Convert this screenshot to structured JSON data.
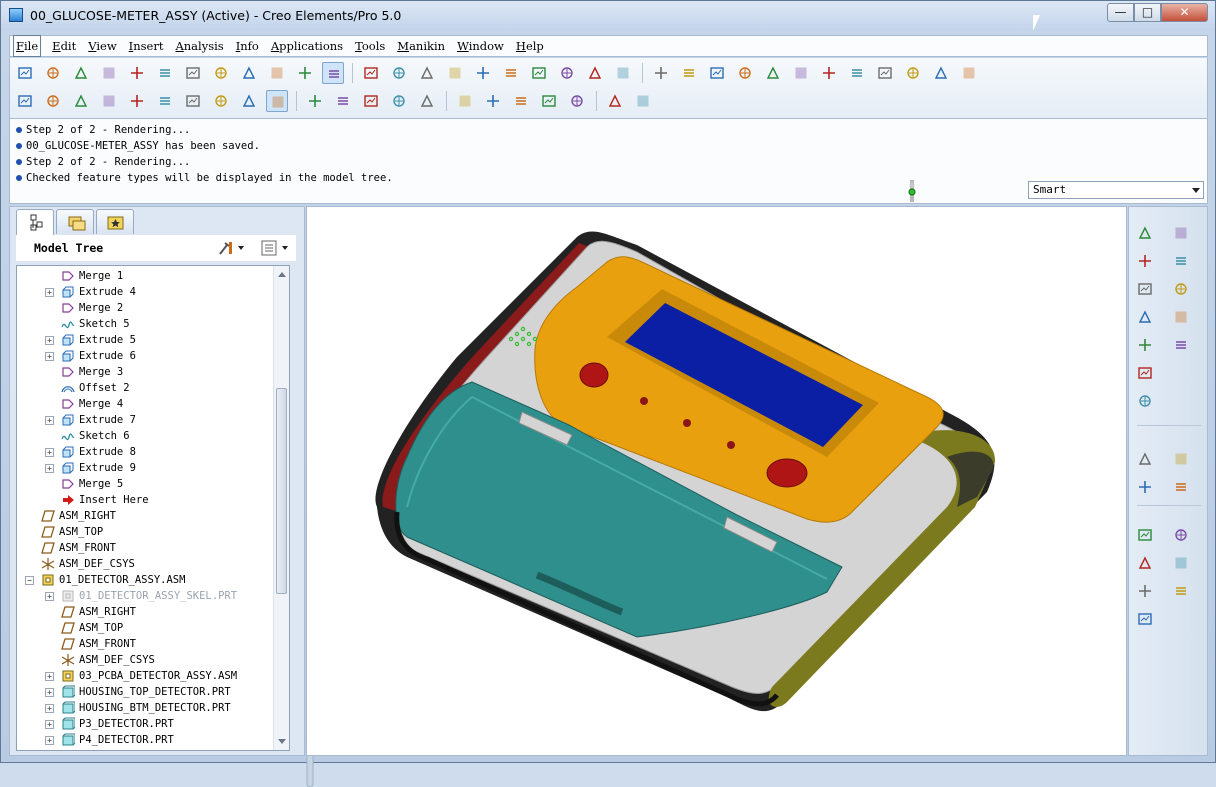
{
  "window": {
    "title": "00_GLUCOSE-METER_ASSY (Active) - Creo Elements/Pro 5.0",
    "controls": {
      "minimize": "—",
      "maximize": "□",
      "close": "✕"
    }
  },
  "menubar": {
    "items": [
      "File",
      "Edit",
      "View",
      "Insert",
      "Analysis",
      "Info",
      "Applications",
      "Tools",
      "Manikin",
      "Window",
      "Help"
    ]
  },
  "messages": [
    "Step 2 of 2 - Rendering...",
    "00_GLUCOSE-METER_ASSY has been saved.",
    "Step 2 of 2 - Rendering...",
    "Checked feature types will be displayed in the model tree."
  ],
  "selection_filter": {
    "value": "Smart"
  },
  "navigator": {
    "tabs": [
      "model-tree-tab",
      "folder-browser-tab",
      "favorites-tab"
    ]
  },
  "model_tree": {
    "title": "Model Tree",
    "rows": [
      {
        "label": "Merge 1",
        "icon": "merge",
        "expand": false,
        "indent": 3
      },
      {
        "label": "Extrude 4",
        "icon": "extrude",
        "expand": true,
        "indent": 3
      },
      {
        "label": "Merge 2",
        "icon": "merge",
        "expand": false,
        "indent": 3
      },
      {
        "label": "Sketch 5",
        "icon": "sketch",
        "expand": false,
        "indent": 3
      },
      {
        "label": "Extrude 5",
        "icon": "extrude",
        "expand": true,
        "indent": 3
      },
      {
        "label": "Extrude 6",
        "icon": "extrude",
        "expand": true,
        "indent": 3
      },
      {
        "label": "Merge 3",
        "icon": "merge",
        "expand": false,
        "indent": 3
      },
      {
        "label": "Offset 2",
        "icon": "offset",
        "expand": false,
        "indent": 3
      },
      {
        "label": "Merge 4",
        "icon": "merge",
        "expand": false,
        "indent": 3
      },
      {
        "label": "Extrude 7",
        "icon": "extrude",
        "expand": true,
        "indent": 3
      },
      {
        "label": "Sketch 6",
        "icon": "sketch",
        "expand": false,
        "indent": 3
      },
      {
        "label": "Extrude 8",
        "icon": "extrude",
        "expand": true,
        "indent": 3
      },
      {
        "label": "Extrude 9",
        "icon": "extrude",
        "expand": true,
        "indent": 3
      },
      {
        "label": "Merge 5",
        "icon": "merge",
        "expand": false,
        "indent": 3
      },
      {
        "label": "Insert Here",
        "icon": "insert-arrow",
        "expand": false,
        "indent": 3
      },
      {
        "label": "ASM_RIGHT",
        "icon": "datum-plane",
        "expand": false,
        "indent": 1
      },
      {
        "label": "ASM_TOP",
        "icon": "datum-plane",
        "expand": false,
        "indent": 1
      },
      {
        "label": "ASM_FRONT",
        "icon": "datum-plane",
        "expand": false,
        "indent": 1
      },
      {
        "label": "ASM_DEF_CSYS",
        "icon": "csys",
        "expand": false,
        "indent": 1
      },
      {
        "label": "01_DETECTOR_ASSY.ASM",
        "icon": "assembly",
        "expand": true,
        "indent": 1,
        "expanded": true
      },
      {
        "label": "01_DETECTOR_ASSY_SKEL.PRT",
        "icon": "skeleton",
        "expand": true,
        "indent": 3,
        "dim": true
      },
      {
        "label": "ASM_RIGHT",
        "icon": "datum-plane",
        "expand": false,
        "indent": 3
      },
      {
        "label": "ASM_TOP",
        "icon": "datum-plane",
        "expand": false,
        "indent": 3
      },
      {
        "label": "ASM_FRONT",
        "icon": "datum-plane",
        "expand": false,
        "indent": 3
      },
      {
        "label": "ASM_DEF_CSYS",
        "icon": "csys",
        "expand": false,
        "indent": 3
      },
      {
        "label": "03_PCBA_DETECTOR_ASSY.ASM",
        "icon": "assembly",
        "expand": true,
        "indent": 3
      },
      {
        "label": "HOUSING_TOP_DETECTOR.PRT",
        "icon": "part",
        "expand": true,
        "indent": 3
      },
      {
        "label": "HOUSING_BTM_DETECTOR.PRT",
        "icon": "part",
        "expand": true,
        "indent": 3
      },
      {
        "label": "P3_DETECTOR.PRT",
        "icon": "part",
        "expand": true,
        "indent": 3
      },
      {
        "label": "P4_DETECTOR.PRT",
        "icon": "part",
        "expand": true,
        "indent": 3
      }
    ]
  },
  "toolbar_row1": [
    "open-existing-icon",
    "open-other-icon",
    "new-file-icon",
    "open-folder-icon",
    "open-recent-icon",
    "edit-definition-icon",
    "regenerate-check-icon",
    "close-window-icon",
    "save-icon",
    "save-copy-icon",
    "print-icon",
    "color-appearance-icon",
    "undo-icon",
    "redo-icon",
    "cut-icon",
    "copy-icon",
    "paste-icon",
    "paste-special-icon",
    "regenerate-icon",
    "regen-manager-icon",
    "find-icon",
    "selection-box-icon",
    "spin-center-icon",
    "orient-mode-icon",
    "shading-sphere-icon",
    "pan-hand-icon",
    "layers-icon",
    "view-manager-icon",
    "refit-icon",
    "zoom-in-icon",
    "zoom-out-icon",
    "zoom-fit-icon",
    "saved-views-icon",
    "annotation-display-icon"
  ],
  "toolbar_row2": [
    "repaint-icon",
    "wireframe-icon",
    "hidden-line-icon",
    "no-hidden-icon",
    "shaded-edges-icon",
    "shaded-icon",
    "view-iso-icon",
    "view-front-icon",
    "view-right-icon",
    "view-3d-icon",
    "datum-planes-display-icon",
    "datum-axes-display-icon",
    "datum-points-display-icon",
    "csys-display-icon",
    "spin-center-display-icon",
    "photo-render-icon",
    "render-scene-icon",
    "render-room-icon",
    "render-lights-icon",
    "render-studio-icon",
    "model-tree-tool-icon",
    "context-help-icon"
  ],
  "right_toolbar": [
    "datum-point-icon",
    "datum-plane-icon",
    "datum-axis-icon",
    "datum-curve-icon",
    "sketch-tool-icon",
    "csys-tool-icon",
    "analysis-measure-icon",
    "assemble-component-icon",
    "create-component-icon",
    "package-component-icon",
    "repeat-component-icon",
    "extrude-tool-icon",
    "revolve-tool-icon",
    "sweep-tool-icon",
    "blend-tool-icon",
    "mirror-tool-icon",
    "merge-tool-icon",
    "trim-tool-icon",
    "pattern-tool-icon",
    "hole-tool-icon",
    "round-tool-icon",
    "chamfer-tool-icon",
    "shell-tool-icon"
  ],
  "colors": {
    "housing_gray": "#d9d9d9",
    "housing_teal": "#2f8f8c",
    "bezel_orange": "#e9a00f",
    "screen_blue": "#0a1fa3",
    "button_red": "#b01515",
    "end_cap_olive": "#7c7a1e"
  }
}
